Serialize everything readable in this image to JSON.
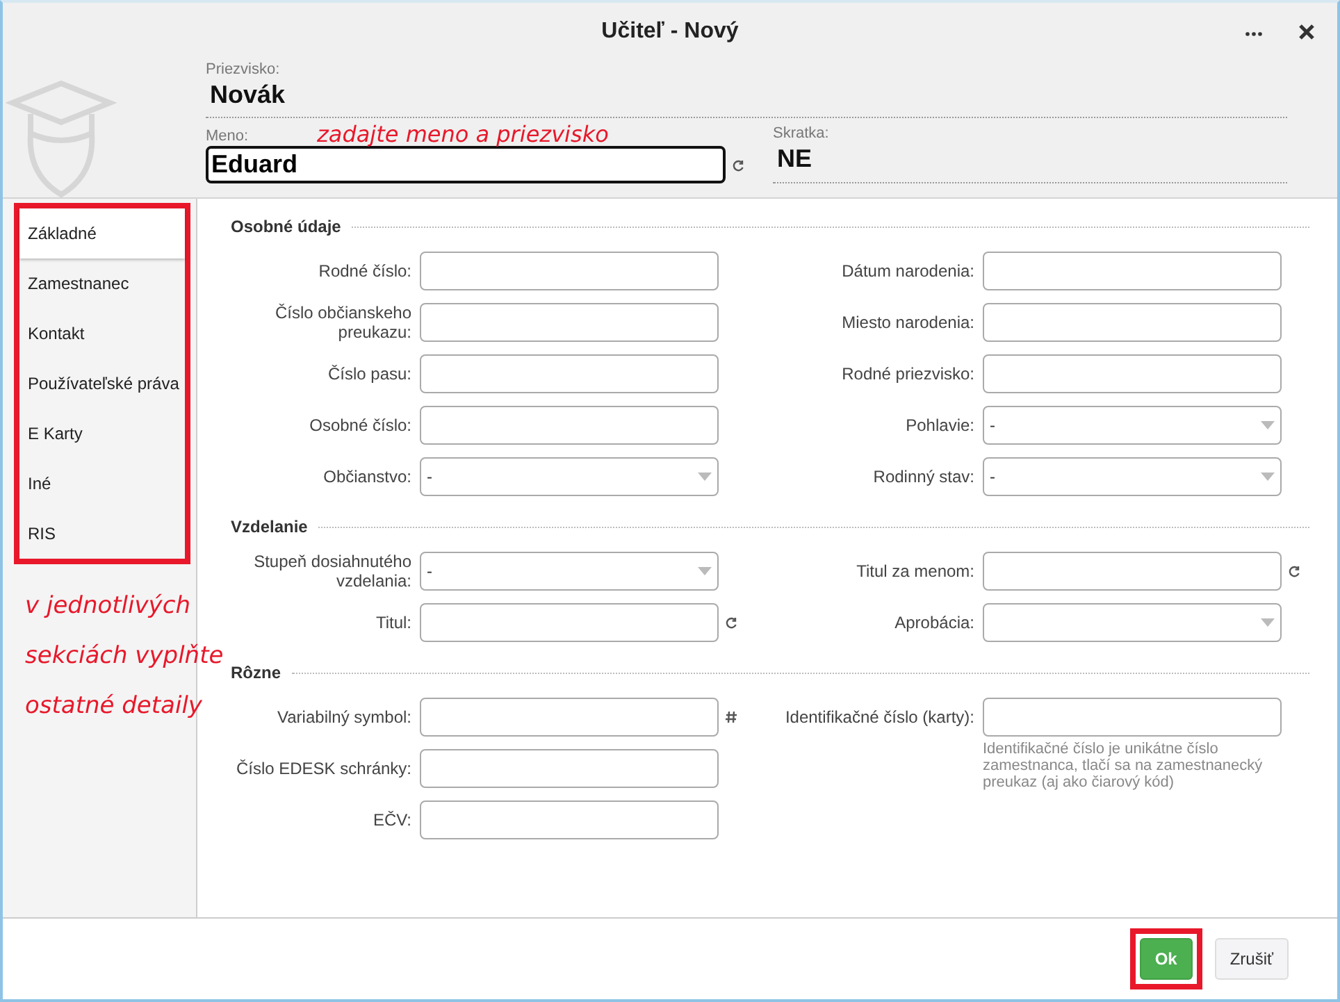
{
  "window": {
    "title": "Učiteľ - Nový"
  },
  "header": {
    "surname": {
      "label": "Priezvisko:",
      "value": "Novák"
    },
    "first_name": {
      "label": "Meno:",
      "value": "Eduard"
    },
    "abbreviation": {
      "label": "Skratka:",
      "value": "NE"
    }
  },
  "annotations": [
    {
      "text": "zadajte meno a priezvisko"
    },
    {
      "text": "v jednotlivých sekciách vyplňte ostatné detaily"
    }
  ],
  "sidebar": {
    "highlighted": true,
    "items": [
      {
        "label": "Základné",
        "selected": true
      },
      {
        "label": "Zamestnanec",
        "selected": false
      },
      {
        "label": "Kontakt",
        "selected": false
      },
      {
        "label": "Používateľské práva",
        "selected": false
      },
      {
        "label": "E Karty",
        "selected": false
      },
      {
        "label": "Iné",
        "selected": false
      },
      {
        "label": "RIS",
        "selected": false
      }
    ]
  },
  "sections": [
    {
      "title": "Osobné údaje",
      "left": [
        {
          "label": "Rodné číslo:",
          "kind": "text"
        },
        {
          "label": "Číslo občianskeho preukazu:",
          "kind": "text"
        },
        {
          "label": "Číslo pasu:",
          "kind": "text"
        },
        {
          "label": "Osobné číslo:",
          "kind": "text"
        },
        {
          "label": "Občianstvo:",
          "kind": "select",
          "value": "-"
        }
      ],
      "right": [
        {
          "label": "Dátum narodenia:",
          "kind": "text"
        },
        {
          "label": "Miesto narodenia:",
          "kind": "text"
        },
        {
          "label": "Rodné priezvisko:",
          "kind": "text"
        },
        {
          "label": "Pohlavie:",
          "kind": "select",
          "value": "-"
        },
        {
          "label": "Rodinný stav:",
          "kind": "select",
          "value": "-"
        }
      ]
    },
    {
      "title": "Vzdelanie",
      "left": [
        {
          "label": "Stupeň dosiahnutého vzdelania:",
          "kind": "select",
          "value": "-"
        },
        {
          "label": "Titul:",
          "kind": "text",
          "refresh_icon": true
        }
      ],
      "right": [
        {
          "label": "Titul za menom:",
          "kind": "text",
          "refresh_icon": true
        },
        {
          "label": "Aprobácia:",
          "kind": "select"
        }
      ]
    },
    {
      "title": "Rôzne",
      "left": [
        {
          "label": "Variabilný symbol:",
          "kind": "text",
          "hash_icon": true
        },
        {
          "label": "Číslo EDESK schránky:",
          "kind": "text"
        },
        {
          "label": "EČV:",
          "kind": "text"
        }
      ],
      "right": [
        {
          "label": "Identifikačné číslo (karty):",
          "kind": "text",
          "hint": "Identifikačné číslo je unikátne číslo zamestnanca, tlačí sa na zamestnanecký preukaz (aj ako čiarový kód)"
        }
      ]
    }
  ],
  "buttons": [
    {
      "label": "Ok",
      "kind": "primary",
      "highlighted": true
    },
    {
      "label": "Zrušiť",
      "kind": "secondary",
      "highlighted": false
    }
  ]
}
